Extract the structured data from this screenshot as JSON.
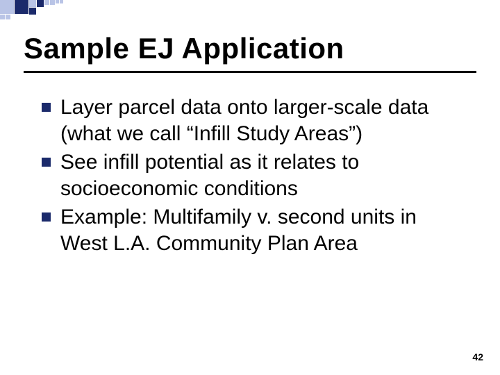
{
  "title": "Sample EJ Application",
  "bullets": [
    "Layer parcel data onto larger-scale data (what we call “Infill Study Areas”)",
    "See infill potential as it relates to socioeconomic conditions",
    "Example: Multifamily v. second units in West L.A. Community Plan Area"
  ],
  "page_number": "42",
  "decor_color_dark": "#1b2a6b",
  "decor_color_light": "#b9c4e6"
}
